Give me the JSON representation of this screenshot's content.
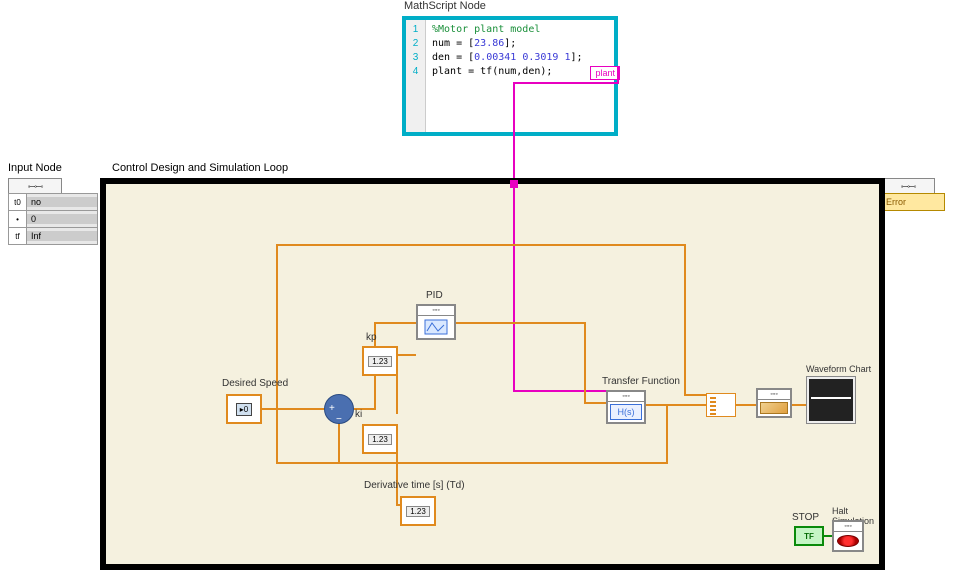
{
  "mathscript": {
    "title": "MathScript Node",
    "lines": [
      "1",
      "2",
      "3",
      "4"
    ],
    "code_comment": "%Motor plant model",
    "code_line2_a": "num = [",
    "code_line2_b": "23.86",
    "code_line2_c": "];",
    "code_line3_a": "den = [",
    "code_line3_b": "0.00341 0.3019 1",
    "code_line3_c": "];",
    "code_line4": "plant = tf(num,den);",
    "output_tag": "plant"
  },
  "input_node": {
    "label": "Input Node",
    "header": "◦─◦─◦",
    "rows": [
      {
        "icon": "t0",
        "val": "no"
      },
      {
        "icon": "•",
        "val": "0"
      },
      {
        "icon": "tf",
        "val": "Inf"
      }
    ]
  },
  "output_node": {
    "header": "◦─◦─◦",
    "error": "Error"
  },
  "loop": {
    "label": "Control Design and Simulation Loop",
    "desired_speed_label": "Desired Speed",
    "kp_label": "kp",
    "ki_label": "ki",
    "td_label": "Derivative time [s] (Td)",
    "pid_label": "PID",
    "tf_label": "Transfer Function",
    "tf_text": "H(s)",
    "chart_label": "Waveform Chart",
    "stop_label": "STOP",
    "stop_text": "TF",
    "halt_label": "Halt Simulation",
    "ctrl_glyph": "1.23",
    "ds_glyph": "▸0"
  }
}
